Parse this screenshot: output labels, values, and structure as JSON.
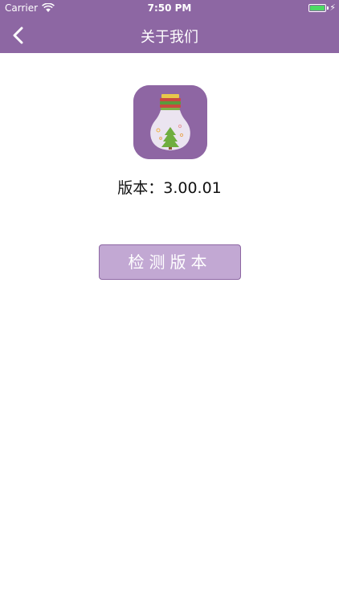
{
  "status_bar": {
    "carrier": "Carrier",
    "time": "7:50 PM",
    "battery_level": 1.0,
    "battery_color": "#4cd964"
  },
  "nav": {
    "back_icon": "chevron-left-icon",
    "title": "关于我们"
  },
  "app": {
    "icon": "lightbulb-tree-icon",
    "version_text": "版本：3.00.01"
  },
  "actions": {
    "check_version_label": "检测版本"
  },
  "colors": {
    "accent": "#8d67a3",
    "button_bg": "#c2a8d3",
    "background": "#ffffff"
  }
}
